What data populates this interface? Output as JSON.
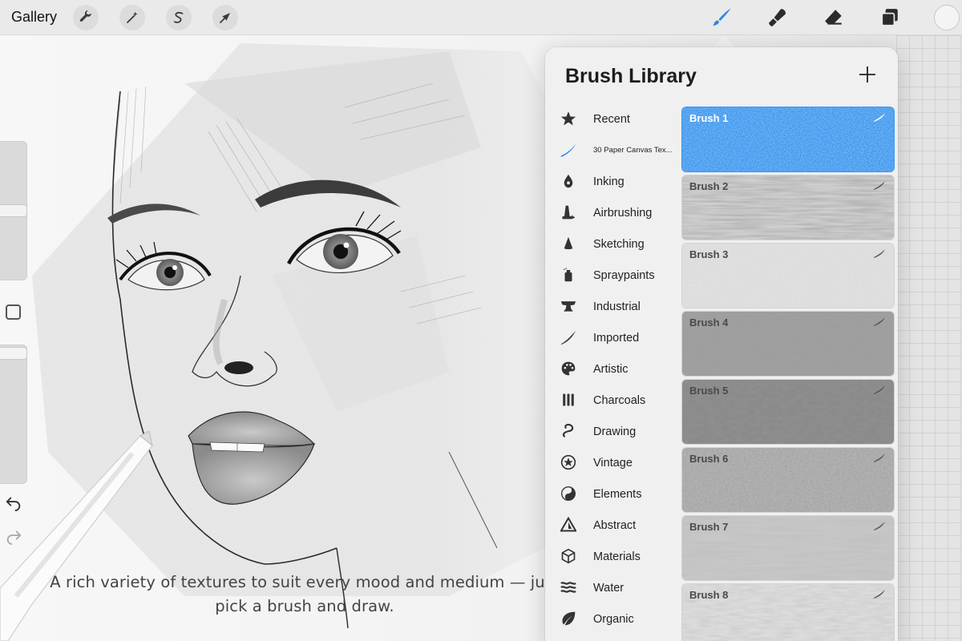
{
  "toolbar": {
    "gallery_label": "Gallery",
    "left_tools": [
      "wrench-icon",
      "magic-wand-icon",
      "selection-s-icon",
      "transform-arrow-icon"
    ],
    "right_tools": [
      "brush-icon",
      "smudge-icon",
      "eraser-icon",
      "layers-icon"
    ],
    "active_tool": "brush-icon",
    "accent_color": "#2f86e6"
  },
  "brush_library": {
    "title": "Brush Library",
    "sets": [
      {
        "label": "Recent",
        "icon": "star-icon"
      },
      {
        "label": "30 Paper Canvas Tex...",
        "icon": "blue-stroke-icon"
      },
      {
        "label": "Inking",
        "icon": "pen-nib-icon"
      },
      {
        "label": "Airbrushing",
        "icon": "airbrush-icon"
      },
      {
        "label": "Sketching",
        "icon": "pencil-tip-icon"
      },
      {
        "label": "Spraypaints",
        "icon": "spray-can-icon"
      },
      {
        "label": "Industrial",
        "icon": "anvil-icon"
      },
      {
        "label": "Imported",
        "icon": "imported-stroke-icon"
      },
      {
        "label": "Artistic",
        "icon": "palette-icon"
      },
      {
        "label": "Charcoals",
        "icon": "charcoal-sticks-icon"
      },
      {
        "label": "Drawing",
        "icon": "squiggle-icon"
      },
      {
        "label": "Vintage",
        "icon": "vintage-star-icon"
      },
      {
        "label": "Elements",
        "icon": "yin-yang-icon"
      },
      {
        "label": "Abstract",
        "icon": "triangle-icon"
      },
      {
        "label": "Materials",
        "icon": "cube-icon"
      },
      {
        "label": "Water",
        "icon": "waves-icon"
      },
      {
        "label": "Organic",
        "icon": "leaf-icon"
      }
    ],
    "brushes": [
      {
        "name": "Brush 1",
        "selected": true
      },
      {
        "name": "Brush 2",
        "selected": false
      },
      {
        "name": "Brush 3",
        "selected": false
      },
      {
        "name": "Brush 4",
        "selected": false
      },
      {
        "name": "Brush 5",
        "selected": false
      },
      {
        "name": "Brush 6",
        "selected": false
      },
      {
        "name": "Brush 7",
        "selected": false
      },
      {
        "name": "Brush 8",
        "selected": false
      }
    ],
    "selected_color": "#3d95ef"
  },
  "caption": "A rich variety of textures to suit every mood and medium — just pick a brush and draw."
}
